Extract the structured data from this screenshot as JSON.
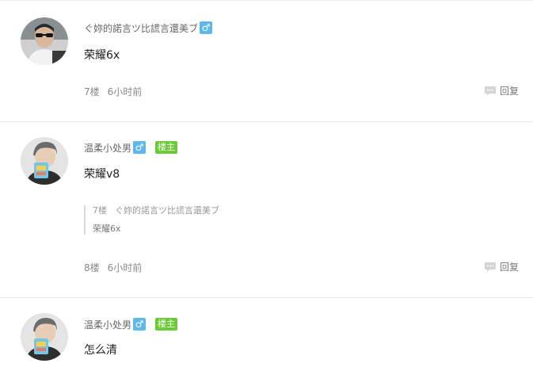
{
  "posts": [
    {
      "username": "ぐ妳的諾言ツ比謊言還美ブ",
      "gender": "♂",
      "is_op": false,
      "content": "荣耀6x",
      "floor": "7楼",
      "time": "6小时前",
      "reply_label": "回复"
    },
    {
      "username": "温柔小处男",
      "gender": "♂",
      "is_op": true,
      "op_label": "楼主",
      "content": "荣耀v8",
      "quote": {
        "floor": "7楼",
        "username": "ぐ妳的諾言ツ比謊言還美ブ",
        "text": "荣耀6x"
      },
      "floor": "8楼",
      "time": "6小时前",
      "reply_label": "回复"
    },
    {
      "username": "温柔小处男",
      "gender": "♂",
      "is_op": true,
      "op_label": "楼主",
      "content": "怎么清"
    }
  ],
  "colors": {
    "gender_badge": "#5eb8e8",
    "op_badge": "#6cc93a",
    "divider": "#e6e6e6"
  }
}
